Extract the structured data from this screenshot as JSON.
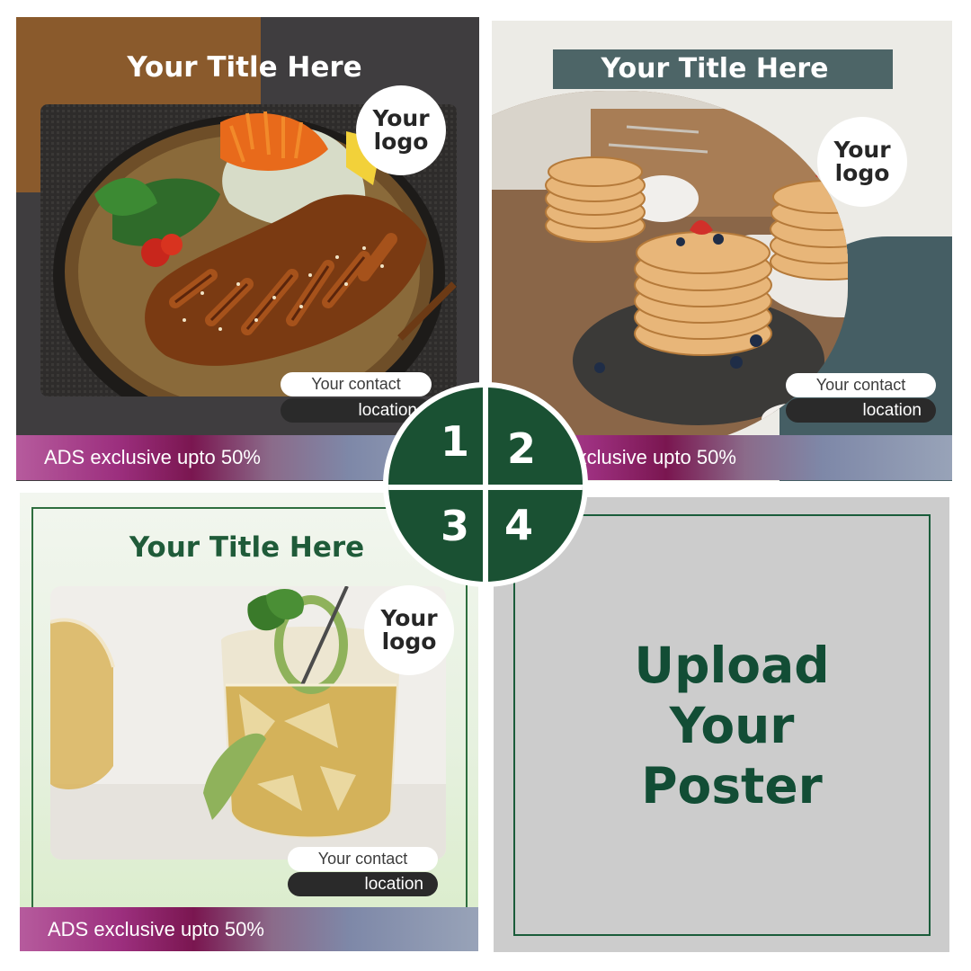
{
  "panels": [
    {
      "title": "Your Title Here",
      "logo": "Your logo",
      "contact": "Your contact",
      "location": "location",
      "ads": "ADS exclusive upto 50%",
      "photo": "grilled-chicken-salad-image"
    },
    {
      "title": "Your Title Here",
      "logo": "Your logo",
      "contact": "Your contact",
      "location": "location",
      "ads": "ADS exclusive upto 50%",
      "photo": "pancakes-berries-image"
    },
    {
      "title": "Your Title Here",
      "logo": "Your logo",
      "contact": "Your contact",
      "location": "location",
      "ads": "ADS exclusive upto 50%",
      "photo": "cucumber-drink-image"
    },
    {
      "upload_text": "Upload Your Poster"
    }
  ],
  "center_numbers": [
    "1",
    "2",
    "3",
    "4"
  ],
  "colors": {
    "dark_green": "#1a5133",
    "brown": "#8a5a2c",
    "charcoal": "#3f3d3f",
    "slate_teal": "#4d6567",
    "poster_gray": "#cccccc",
    "ads_magenta": "#9c2f7e"
  }
}
